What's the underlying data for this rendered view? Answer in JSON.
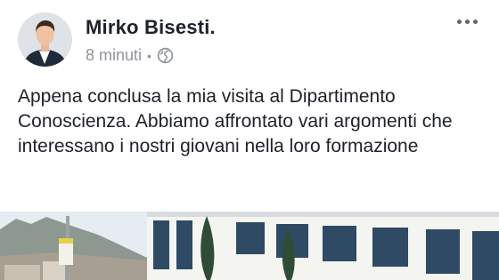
{
  "post": {
    "author": "Mirko Bisesti.",
    "time": "8 minuti",
    "separator": "•",
    "privacy_icon": "globe-icon",
    "more_icon": "more-options-icon",
    "text": "Appena conclusa la mia visita al Dipartimento Conoscienza. Abbiamo affrontato vari argomenti che interessano i nostri giovani nella loro formazione"
  },
  "colors": {
    "name": "#1d2129",
    "meta": "#90949c",
    "text": "#1d2129"
  }
}
